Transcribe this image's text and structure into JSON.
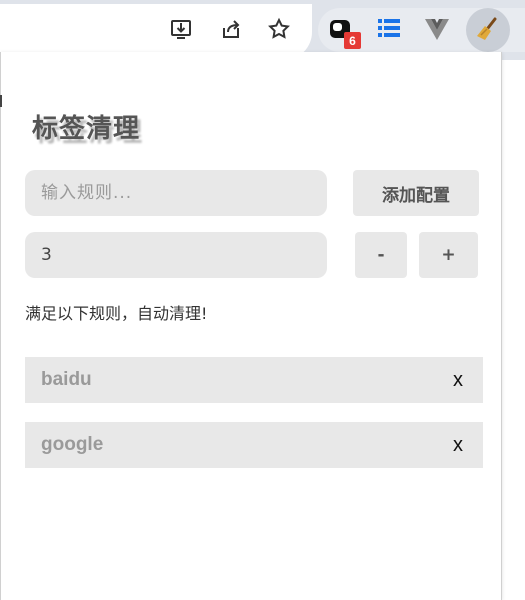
{
  "browser": {
    "extension_badge_count": "6",
    "icons": [
      "install-app-icon",
      "share-icon",
      "bookmark-star-icon",
      "extension-icon",
      "list-extension-icon",
      "vue-extension-icon",
      "broom-extension-icon"
    ]
  },
  "popup": {
    "title": "标签清理",
    "rule_input": {
      "placeholder": "输入规则...",
      "value": ""
    },
    "add_button_label": "添加配置",
    "count_field": {
      "value": "3"
    },
    "decrement_label": "-",
    "increment_label": "+",
    "hint": "满足以下规则，自动清理!",
    "rules": [
      {
        "label": "baidu",
        "remove_label": "x"
      },
      {
        "label": "google",
        "remove_label": "x"
      }
    ]
  },
  "colors": {
    "field_bg": "#e8e8e8",
    "badge_red": "#e53935",
    "toolbar_bg": "#dfe3ea"
  }
}
